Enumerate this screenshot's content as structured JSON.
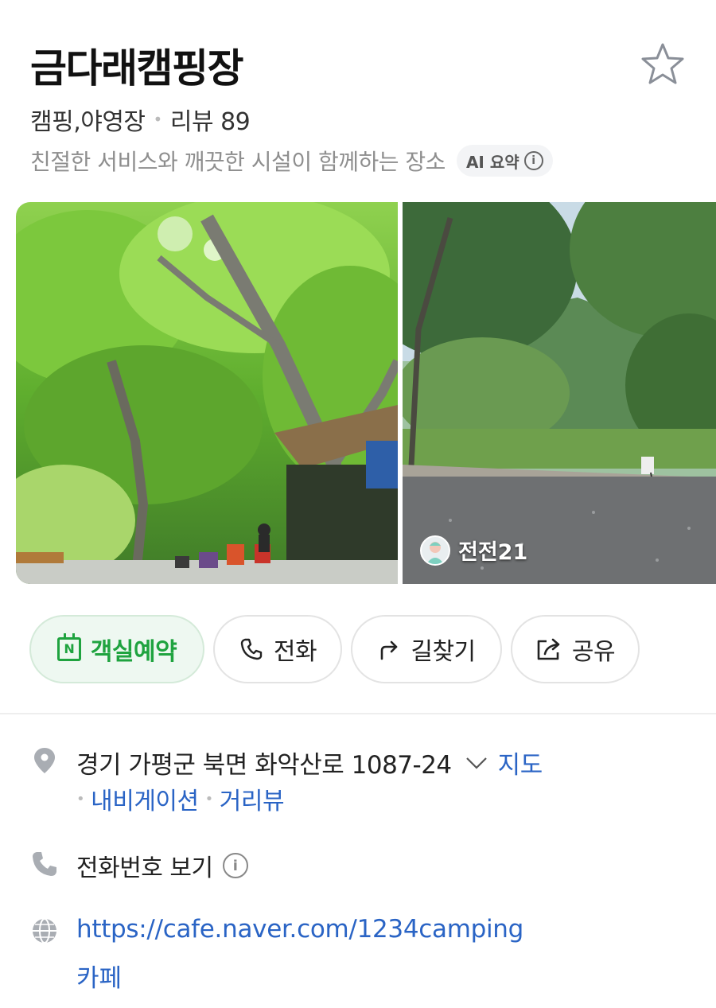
{
  "place": {
    "name": "금다래캠핑장",
    "category": "캠핑,야영장",
    "review_label": "리뷰 89",
    "summary": "친절한 서비스와 깨끗한 시설이 함께하는 장소",
    "ai_badge": "AI 요약",
    "favorite_icon": "star-outline-icon"
  },
  "photos": {
    "credit_user": "전전21"
  },
  "actions": {
    "reserve": "객실예약",
    "call": "전화",
    "route": "길찾기",
    "share": "공유"
  },
  "info": {
    "address": "경기 가평군 북면 화악산로 1087-24",
    "map_link": "지도",
    "navigation_link": "내비게이션",
    "street_view_link": "거리뷰",
    "phone_label": "전화번호 보기",
    "website_url": "https://cafe.naver.com/1234camping",
    "website_label": "카페"
  },
  "colors": {
    "accent_green": "#1fa33f",
    "link_blue": "#2a64c5",
    "muted_gray": "#8e8e8e"
  }
}
